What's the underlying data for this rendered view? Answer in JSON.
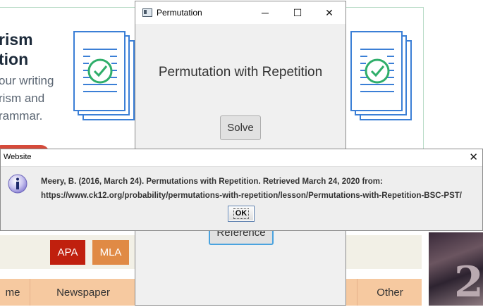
{
  "background_page": {
    "title_lines": "rism\ntion",
    "description_lines": "our writing\nrism and\nrammar.",
    "citation_styles": [
      {
        "label": "APA",
        "color": "#c0200e"
      },
      {
        "label": "MLA",
        "color": "#e08a45"
      }
    ],
    "source_tabs": [
      "me",
      "Newspaper",
      "Other"
    ]
  },
  "permutation_window": {
    "title": "Permutation",
    "heading": "Permutation with Repetition",
    "solve_label": "Solve",
    "reference_label": "Reference",
    "controls": {
      "minimize": "─",
      "maximize": "☐",
      "close": "✕"
    }
  },
  "website_dialog": {
    "title": "Website",
    "message_line1": "Meery, B. (2016, March 24). Permutations with Repetition. Retrieved March 24, 2020 from:",
    "message_line2": "https://www.ck12.org/probability/permutations-with-repetition/lesson/Permutations-with-Repetition-BSC-PST/",
    "ok_label": "OK",
    "close_glyph": "✕"
  },
  "colors": {
    "doc_icon_blue": "#3b7fd6",
    "check_green": "#2fae6a",
    "dialog_border": "#5b7fae"
  }
}
